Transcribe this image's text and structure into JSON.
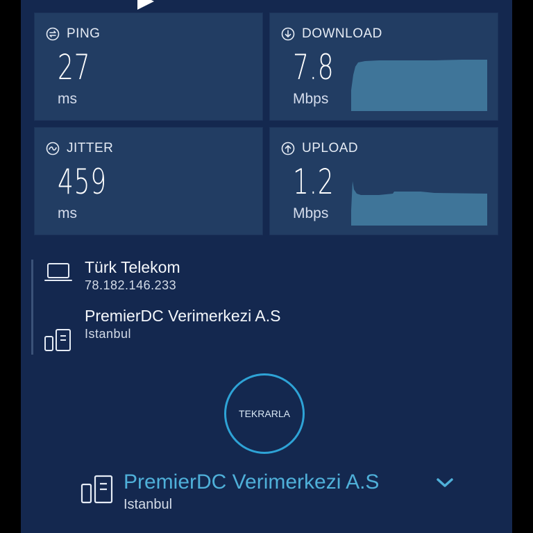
{
  "colors": {
    "background": "#14284f",
    "card": "#223d63",
    "accent": "#4fb0d9",
    "chart": "#3f7599"
  },
  "cards": {
    "ping": {
      "label": "PING",
      "value": "27",
      "unit": "ms",
      "icon": "ping-icon"
    },
    "download": {
      "label": "DOWNLOAD",
      "value": "7.8",
      "unit": "Mbps",
      "icon": "download-icon"
    },
    "jitter": {
      "label": "JITTER",
      "value": "459",
      "unit": "ms",
      "icon": "jitter-icon"
    },
    "upload": {
      "label": "UPLOAD",
      "value": "1.2",
      "unit": "Mbps",
      "icon": "upload-icon"
    }
  },
  "provider": {
    "name": "Türk Telekom",
    "ip": "78.182.146.233",
    "icon": "laptop-icon"
  },
  "host": {
    "name": "PremierDC Verimerkezi A.S",
    "city": "Istanbul",
    "icon": "server-icon"
  },
  "actions": {
    "retry_label": "TEKRARLA"
  },
  "selected_server": {
    "name": "PremierDC Verimerkezi A.S",
    "city": "Istanbul",
    "icon": "chevron-down-icon"
  }
}
